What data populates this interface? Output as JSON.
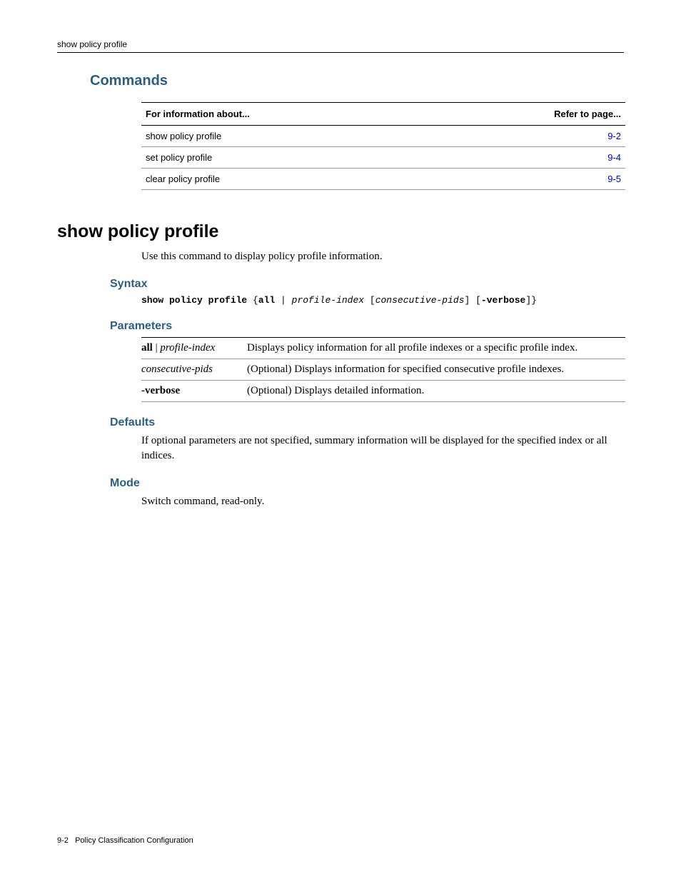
{
  "header": {
    "running_title": "show policy profile"
  },
  "commands": {
    "heading": "Commands",
    "th_info": "For information about...",
    "th_page": "Refer to page...",
    "rows": [
      {
        "label": "show policy profile",
        "page": "9-2"
      },
      {
        "label": "set policy profile",
        "page": "9-4"
      },
      {
        "label": "clear policy profile",
        "page": "9-5"
      }
    ]
  },
  "section": {
    "title": "show policy profile",
    "intro": "Use this command to display policy profile information."
  },
  "syntax": {
    "heading": "Syntax",
    "cmd": "show policy profile",
    "brace_open": " {",
    "all": "all",
    "pipe": " | ",
    "profile_index": "profile-index",
    "space_lbrack": " [",
    "consecutive": "consecutive-pids",
    "rbrack_sp_lbrack": "] [",
    "verbose": "-verbose",
    "end": "]}"
  },
  "parameters": {
    "heading": "Parameters",
    "rows": [
      {
        "name_bold": "all",
        "name_sep": " | ",
        "name_ital": "profile-index",
        "desc": "Displays policy information for all profile indexes or a specific profile index."
      },
      {
        "name_ital_only": "consecutive-pids",
        "desc": "(Optional) Displays information for specified consecutive profile indexes."
      },
      {
        "name_bold_only": "-verbose",
        "desc": "(Optional) Displays detailed information."
      }
    ]
  },
  "defaults": {
    "heading": "Defaults",
    "text": "If optional parameters are not specified, summary information will be displayed for the specified index or all indices."
  },
  "mode": {
    "heading": "Mode",
    "text": "Switch command, read-only."
  },
  "footer": {
    "page": "9-2",
    "title": "Policy Classification Configuration"
  }
}
